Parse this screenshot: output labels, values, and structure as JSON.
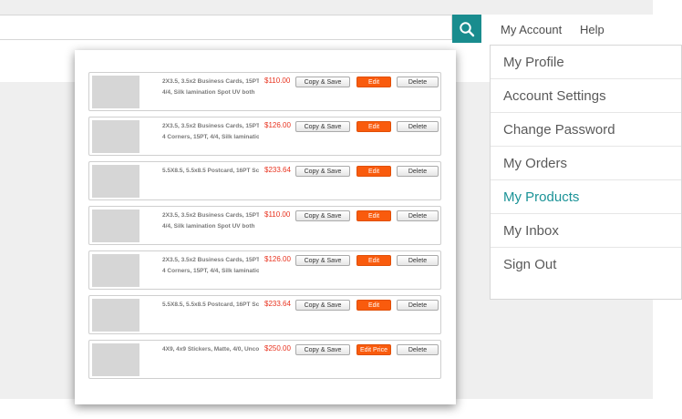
{
  "header": {
    "search": {
      "value": "",
      "placeholder": ""
    },
    "search_icon": "search-icon",
    "nav": {
      "account": "My Account",
      "help": "Help"
    }
  },
  "products": [
    {
      "desc1": "2X3.5, 3.5x2 Business Cards, 15PT",
      "desc2": "4/4, Silk lamination Spot UV both",
      "price": "$110.00",
      "copy": "Copy & Save",
      "edit": "Edit",
      "delete": "Delete"
    },
    {
      "desc1": "2X3.5, 3.5x2 Business Cards, 15PT",
      "desc2": "4 Corners, 15PT, 4/4, Silk laminatio",
      "price": "$126.00",
      "copy": "Copy & Save",
      "edit": "Edit",
      "delete": "Delete"
    },
    {
      "desc1": "5.5X8.5, 5.5x8.5 Postcard, 16PT Sc",
      "desc2": "",
      "price": "$233.64",
      "copy": "Copy & Save",
      "edit": "Edit",
      "delete": "Delete"
    },
    {
      "desc1": "2X3.5, 3.5x2 Business Cards, 15PT",
      "desc2": "4/4, Silk lamination Spot UV both",
      "price": "$110.00",
      "copy": "Copy & Save",
      "edit": "Edit",
      "delete": "Delete"
    },
    {
      "desc1": "2X3.5, 3.5x2 Business Cards, 15PT",
      "desc2": "4 Corners, 15PT, 4/4, Silk laminatio",
      "price": "$126.00",
      "copy": "Copy & Save",
      "edit": "Edit",
      "delete": "Delete"
    },
    {
      "desc1": "5.5X8.5, 5.5x8.5 Postcard, 16PT Sc",
      "desc2": "",
      "price": "$233.64",
      "copy": "Copy & Save",
      "edit": "Edit",
      "delete": "Delete"
    },
    {
      "desc1": "4X9, 4x9 Stickers, Matte, 4/0, Unco",
      "desc2": "",
      "price": "$250.00",
      "copy": "Copy & Save",
      "edit": "Edit Price",
      "delete": "Delete"
    }
  ],
  "menu": [
    {
      "label": "My Profile",
      "active": false
    },
    {
      "label": "Account Settings",
      "active": false
    },
    {
      "label": "Change Password",
      "active": false
    },
    {
      "label": "My Orders",
      "active": false
    },
    {
      "label": "My Products",
      "active": true
    },
    {
      "label": "My Inbox",
      "active": false
    },
    {
      "label": "Sign Out",
      "active": false
    }
  ],
  "colors": {
    "accent": "#198c8e",
    "menu_active": "#1b9397",
    "edit_button": "#f95b0d",
    "price": "#e8321e",
    "background": "#efefef"
  }
}
